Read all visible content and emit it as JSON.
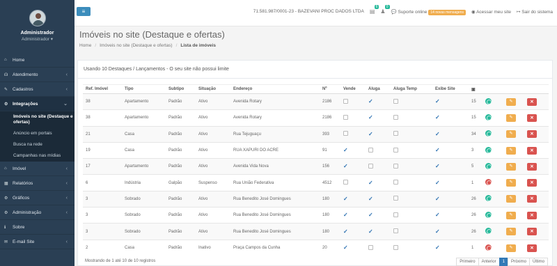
{
  "profile": {
    "name": "Administrador",
    "role": "Administrador ▾"
  },
  "sidebar": {
    "items": [
      {
        "icon": "home-icon",
        "label": "Home",
        "chev": ""
      },
      {
        "icon": "headset-icon",
        "label": "Atendimento",
        "chev": "‹"
      },
      {
        "icon": "wrench-icon",
        "label": "Cadastros",
        "chev": "‹"
      },
      {
        "icon": "gear-icon",
        "label": "Integrações",
        "chev": "⌄"
      }
    ],
    "sub_items": [
      "Imóveis no site (Destaque e ofertas)",
      "Anúncio em portais",
      "Busca na rede",
      "Campanhas nas mídias"
    ],
    "items_after": [
      {
        "icon": "home-icon",
        "label": "Imóvel",
        "chev": "‹"
      },
      {
        "icon": "file-icon",
        "label": "Relatórios",
        "chev": "‹"
      },
      {
        "icon": "gear-icon",
        "label": "Gráficos",
        "chev": "‹"
      },
      {
        "icon": "gear-icon",
        "label": "Administração",
        "chev": "‹"
      },
      {
        "icon": "info-icon",
        "label": "Sobre",
        "chev": ""
      },
      {
        "icon": "mail-icon",
        "label": "E-mail Site",
        "chev": "‹"
      }
    ]
  },
  "topbar": {
    "toggle": "≡",
    "company": "71.581.987/0001-23 - BAZEVANI PROC DADOS LTDA",
    "badge1": "6",
    "badge2": "0",
    "support": "Suporte online",
    "support_tag": "14 novas mensagens",
    "site_link": "Acessar meu site",
    "logout": "Sair do sistema"
  },
  "page": {
    "title": "Imóveis no site (Destaque e ofertas)",
    "breadcrumb": [
      "Home",
      "Imóveis no site (Destaque e ofertas)",
      "Lista de imóveis"
    ]
  },
  "panel": {
    "heading": "Usando 10 Destaques / Lançamentos - O seu site não possui limite",
    "columns": [
      "Ref. Imóvel",
      "Tipo",
      "Subtipo",
      "Situação",
      "Endereço",
      "Nº",
      "Vende",
      "Aluga",
      "Aluga Temp",
      "Exibe Site",
      "",
      "",
      "",
      ""
    ],
    "rows": [
      {
        "ref": "38",
        "tipo": "Apartamento",
        "subtipo": "Padrão",
        "situacao": "Ativo",
        "endereco": "Avenida Rotary",
        "num": "2186",
        "vende": false,
        "aluga": true,
        "temp": false,
        "exibe": true,
        "count": "15",
        "globe": "green"
      },
      {
        "ref": "38",
        "tipo": "Apartamento",
        "subtipo": "Padrão",
        "situacao": "Ativo",
        "endereco": "Avenida Rotary",
        "num": "2186",
        "vende": false,
        "aluga": true,
        "temp": false,
        "exibe": true,
        "count": "15",
        "globe": "green"
      },
      {
        "ref": "21",
        "tipo": "Casa",
        "subtipo": "Padrão",
        "situacao": "Ativo",
        "endereco": "Rua Tejuguaçu",
        "num": "393",
        "vende": false,
        "aluga": true,
        "temp": false,
        "exibe": true,
        "count": "34",
        "globe": "green"
      },
      {
        "ref": "19",
        "tipo": "Casa",
        "subtipo": "Padrão",
        "situacao": "Ativo",
        "endereco": "RUA XAPURI DO ACRE",
        "num": "91",
        "vende": true,
        "aluga": false,
        "temp": false,
        "exibe": true,
        "count": "3",
        "globe": "green"
      },
      {
        "ref": "17",
        "tipo": "Apartamento",
        "subtipo": "Padrão",
        "situacao": "Ativo",
        "endereco": "Avenida Vida Nova",
        "num": "156",
        "vende": true,
        "aluga": false,
        "temp": false,
        "exibe": true,
        "count": "5",
        "globe": "green"
      },
      {
        "ref": "6",
        "tipo": "Indústria",
        "subtipo": "Galpão",
        "situacao": "Suspenso",
        "endereco": "Rua União Federativa",
        "num": "4512",
        "vende": false,
        "aluga": true,
        "temp": false,
        "exibe": true,
        "count": "1",
        "globe": "red"
      },
      {
        "ref": "3",
        "tipo": "Sobrado",
        "subtipo": "Padrão",
        "situacao": "Ativo",
        "endereco": "Rua Benedito José Domingues",
        "num": "180",
        "vende": true,
        "aluga": true,
        "temp": false,
        "exibe": true,
        "count": "26",
        "globe": "green"
      },
      {
        "ref": "3",
        "tipo": "Sobrado",
        "subtipo": "Padrão",
        "situacao": "Ativo",
        "endereco": "Rua Benedito José Domingues",
        "num": "180",
        "vende": true,
        "aluga": true,
        "temp": false,
        "exibe": true,
        "count": "26",
        "globe": "green"
      },
      {
        "ref": "3",
        "tipo": "Sobrado",
        "subtipo": "Padrão",
        "situacao": "Ativo",
        "endereco": "Rua Benedito José Domingues",
        "num": "180",
        "vende": true,
        "aluga": true,
        "temp": false,
        "exibe": true,
        "count": "26",
        "globe": "green"
      },
      {
        "ref": "2",
        "tipo": "Casa",
        "subtipo": "Padrão",
        "situacao": "Inativo",
        "endereco": "Praça Campos da Cunha",
        "num": "20",
        "vende": true,
        "aluga": false,
        "temp": false,
        "exibe": true,
        "count": "1",
        "globe": "red"
      }
    ],
    "footer": "Mostrando de 1 até 10 de 10 registros",
    "pager": [
      "Primeiro",
      "Anterior",
      "1",
      "Próximo",
      "Último"
    ],
    "pager_active": "1"
  },
  "colors": {
    "sidebar": "#2a3f54",
    "accent": "#3c8dbc",
    "green": "#26b99a",
    "orange": "#f0ad4e",
    "red": "#d9534f"
  }
}
